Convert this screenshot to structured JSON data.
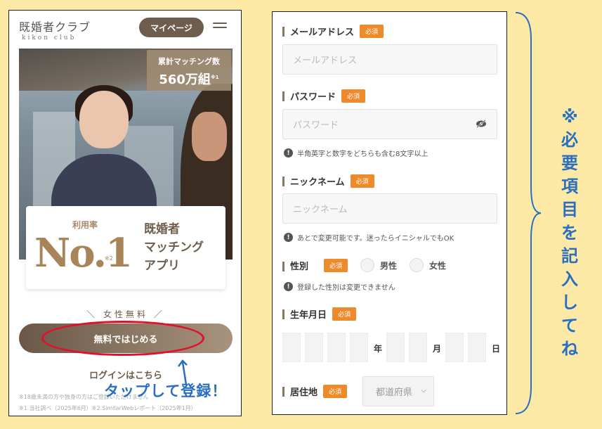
{
  "left_screen": {
    "logo_jp": "既婚者クラブ",
    "logo_en": "kikon club",
    "mypage_label": "マイページ",
    "stat_label": "累計マッチング数",
    "stat_value": "560万組",
    "stat_note": "※1",
    "usage_label": "利用率",
    "no1_text": "No.1",
    "no1_note": "※2",
    "category_line1": "既婚者",
    "category_line2": "マッチング",
    "category_line3": "アプリ",
    "free_label": "＼ 女性無料 ／",
    "start_button": "無料ではじめる",
    "login_link": "ログインはこちら",
    "footnote_1": "※18歳未満の方や独身の方はご登録いただけません",
    "footnote_2": "※1.当社調べ（2025年6月）※2.SimilarWebレポート（2025年1月）"
  },
  "annotation_tap": "タップして登録！",
  "form": {
    "email_label": "メールアドレス",
    "email_placeholder": "メールアドレス",
    "password_label": "パスワード",
    "password_placeholder": "パスワード",
    "password_hint": "半角英字と数字をどちらも含む8文字以上",
    "nickname_label": "ニックネーム",
    "nickname_placeholder": "ニックネーム",
    "nickname_hint": "あとで変更可能です。迷ったらイニシャルでもOK",
    "gender_label": "性別",
    "gender_male": "男性",
    "gender_female": "女性",
    "gender_hint": "登録した性別は変更できません",
    "birthdate_label": "生年月日",
    "year_unit": "年",
    "month_unit": "月",
    "day_unit": "日",
    "residence_label": "居住地",
    "prefecture_placeholder": "都道府県",
    "required_badge": "必須"
  },
  "annotation_required": "※必要項目を記入してね",
  "colors": {
    "accent_brown": "#6e5d4c",
    "required_orange": "#ef8a2b",
    "annotation_blue": "#2a6ec2",
    "highlight_red": "#e2102a",
    "background": "#fde9a6"
  }
}
